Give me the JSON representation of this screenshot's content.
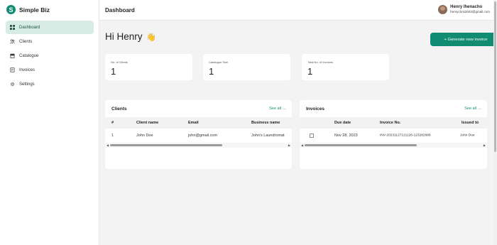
{
  "brand": {
    "name": "Simple Biz",
    "logo_letter": "S"
  },
  "sidebar": {
    "items": [
      {
        "label": "Dashboard",
        "icon": "grid-icon",
        "active": true
      },
      {
        "label": "Clients",
        "icon": "users-icon",
        "active": false
      },
      {
        "label": "Catalogue",
        "icon": "store-icon",
        "active": false
      },
      {
        "label": "Invoices",
        "icon": "invoice-icon",
        "active": false
      },
      {
        "label": "Settings",
        "icon": "settings-icon",
        "active": false
      }
    ]
  },
  "header": {
    "title": "Dashboard",
    "user": {
      "name": "Henry Ihenacho",
      "email": "henrychris2003@gmail.com"
    }
  },
  "main": {
    "greeting": "Hi Henry",
    "greeting_emoji": "👋",
    "new_invoice_button": "+ Generate new invoice",
    "stats": [
      {
        "label": "No. of Clients",
        "value": "1"
      },
      {
        "label": "Catalogue Size",
        "value": "1"
      },
      {
        "label": "Total No. of Invoices",
        "value": "1"
      }
    ],
    "clients_panel": {
      "title": "Clients",
      "see_all": "See all →",
      "columns": [
        "#",
        "Client name",
        "Email",
        "Business name"
      ],
      "rows": [
        [
          "1",
          "John Doe",
          "john@gmail.com",
          "John's Laundromat"
        ]
      ]
    },
    "invoices_panel": {
      "title": "Invoices",
      "see_all": "See all →",
      "columns": [
        "",
        "Due date",
        "Invoice No.",
        "Issued to"
      ],
      "rows": [
        [
          "",
          "Nov 28, 2023",
          "INV-20231127121126-123282686",
          "John Doe"
        ]
      ]
    }
  },
  "colors": {
    "accent": "#128b73",
    "active_nav_bg": "#d8ece6",
    "page_bg": "#f3f3f3"
  }
}
